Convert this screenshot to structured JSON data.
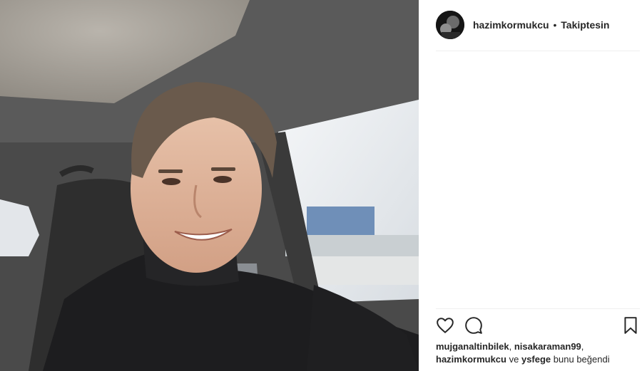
{
  "post": {
    "author": "hazimkormukcu",
    "separator": "•",
    "follow_state": "Takiptesin"
  },
  "likes": {
    "user1": "mujganaltinbilek",
    "comma1": ",",
    "user2": "nisakaraman99",
    "comma2": ",",
    "user3": "hazimkormukcu",
    "and_word": "ve",
    "user4": "ysfege",
    "suffix": "bunu beğendi"
  },
  "icons": {
    "like": "heart-outline-icon",
    "comment": "comment-bubble-icon",
    "save": "bookmark-icon"
  },
  "colors": {
    "text": "#262626",
    "divider": "#efefef",
    "background": "#ffffff"
  }
}
